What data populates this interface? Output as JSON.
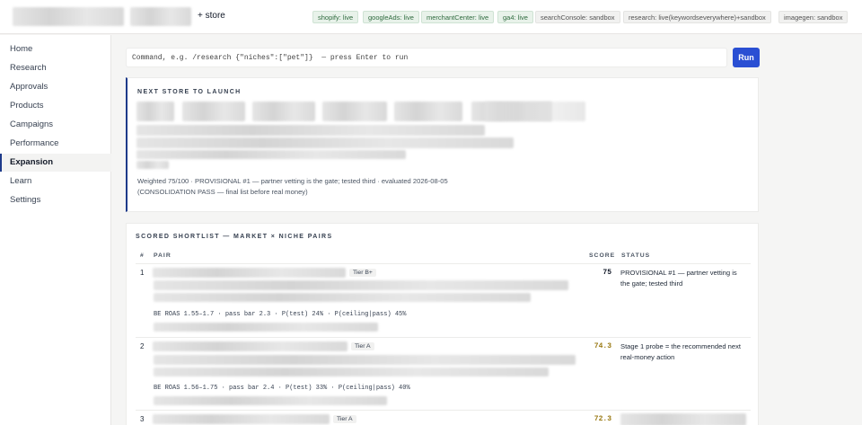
{
  "topbar": {
    "add_store_label": "+ store",
    "integrations": [
      {
        "label": "shopify: live",
        "status": "live"
      },
      {
        "label": "googleAds: live",
        "status": "live"
      },
      {
        "label": "merchantCenter: live",
        "status": "live"
      },
      {
        "label": "ga4: live",
        "status": "live"
      },
      {
        "label": "searchConsole: sandbox",
        "status": "sandbox"
      },
      {
        "label": "research: live(keywordseverywhere)+sandbox",
        "status": "sandbox"
      },
      {
        "label": "imagegen: sandbox",
        "status": "sandbox"
      }
    ]
  },
  "sidebar": {
    "items": [
      {
        "label": "Home"
      },
      {
        "label": "Research"
      },
      {
        "label": "Approvals"
      },
      {
        "label": "Products"
      },
      {
        "label": "Campaigns"
      },
      {
        "label": "Performance"
      },
      {
        "label": "Expansion",
        "active": true
      },
      {
        "label": "Learn"
      },
      {
        "label": "Settings"
      }
    ]
  },
  "command": {
    "placeholder": "Command, e.g. /research {\"niches\":[\"pet\"]}  — press Enter to run",
    "run_label": "Run"
  },
  "next_store": {
    "title": "NEXT STORE TO LAUNCH",
    "summary_line1": "Weighted 75/100 · PROVISIONAL #1 — partner vetting is the gate; tested third · evaluated 2026-08-05",
    "summary_line2": "(CONSOLIDATION PASS — final list before real money)"
  },
  "shortlist": {
    "title": "SCORED SHORTLIST — MARKET × NICHE PAIRS",
    "columns": {
      "num": "#",
      "pair": "PAIR",
      "score": "SCORE",
      "status": "STATUS"
    },
    "rows": [
      {
        "num": "1",
        "tier": "Tier B+",
        "stats": "BE ROAS 1.55–1.7 · pass bar 2.3 · P(test) 24% · P(ceiling|pass) 45%",
        "score": "75",
        "status": "PROVISIONAL #1 — partner vetting is the gate; tested third"
      },
      {
        "num": "2",
        "tier": "Tier A",
        "stats": "BE ROAS 1.56–1.75 · pass bar 2.4 · P(test) 33% · P(ceiling|pass) 40%",
        "score": "74.3",
        "status": "Stage 1 probe = the recommended next real-money action"
      },
      {
        "num": "3",
        "tier": "Tier A",
        "stats": "",
        "score": "72.3",
        "status": ""
      }
    ]
  },
  "colors": {
    "accent": "#2a4fd3",
    "nav_active": "#1e3a8a",
    "score_gold": "#9a7a14",
    "live": "#2f6b3e"
  }
}
